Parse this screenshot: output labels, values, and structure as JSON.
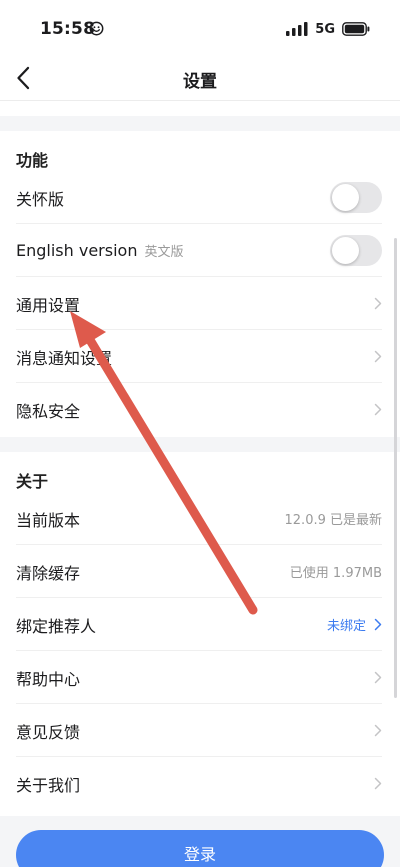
{
  "status_bar": {
    "time": "15:58",
    "network": "5G"
  },
  "nav": {
    "title": "设置"
  },
  "functions": {
    "title": "功能",
    "care_mode": {
      "label": "关怀版",
      "on": false
    },
    "english_version": {
      "label": "English version",
      "sub": "英文版",
      "on": false
    },
    "general_settings": "通用设置",
    "notification_settings": "消息通知设置",
    "privacy_security": "隐私安全"
  },
  "about": {
    "title": "关于",
    "version": {
      "label": "当前版本",
      "value": "12.0.9 已是最新"
    },
    "clear_cache": {
      "label": "清除缓存",
      "value": "已使用 1.97MB"
    },
    "bind_referrer": {
      "label": "绑定推荐人",
      "value": "未绑定"
    },
    "help_center": "帮助中心",
    "feedback": "意见反馈",
    "about_us": "关于我们"
  },
  "login": {
    "label": "登录"
  },
  "colors": {
    "accent": "#4b86f2",
    "link": "#3d7cf0",
    "annotation": "#de5a4c"
  }
}
